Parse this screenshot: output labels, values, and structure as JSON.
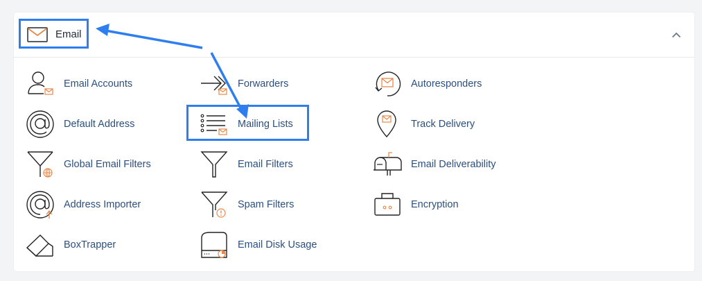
{
  "section": {
    "title": "Email",
    "header_icon": "envelope-icon",
    "collapse_icon": "chevron-up-icon"
  },
  "colors": {
    "accent_orange": "#e8894a",
    "link_blue": "#2b4f7e",
    "highlight_blue": "#2f7ef0"
  },
  "items": [
    {
      "label": "Email Accounts",
      "icon": "user-envelope-icon"
    },
    {
      "label": "Forwarders",
      "icon": "forward-arrow-icon"
    },
    {
      "label": "Autoresponders",
      "icon": "autoresponder-icon"
    },
    {
      "label": "Default Address",
      "icon": "at-sign-icon"
    },
    {
      "label": "Mailing Lists",
      "icon": "list-envelope-icon"
    },
    {
      "label": "Track Delivery",
      "icon": "location-pin-icon"
    },
    {
      "label": "Global Email Filters",
      "icon": "funnel-globe-icon"
    },
    {
      "label": "Email Filters",
      "icon": "funnel-icon"
    },
    {
      "label": "Email Deliverability",
      "icon": "mailbox-icon"
    },
    {
      "label": "Address Importer",
      "icon": "at-upload-icon"
    },
    {
      "label": "Spam Filters",
      "icon": "funnel-warning-icon"
    },
    {
      "label": "Encryption",
      "icon": "briefcase-icon"
    },
    {
      "label": "BoxTrapper",
      "icon": "box-trap-icon"
    },
    {
      "label": "Email Disk Usage",
      "icon": "disk-usage-icon"
    }
  ]
}
